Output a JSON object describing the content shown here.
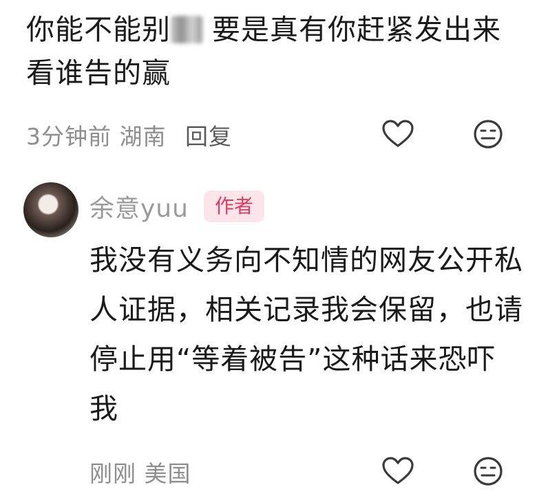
{
  "comment_top": {
    "text_before_blur": "你能不能别",
    "text_after_blur": "要是真有你赶紧发出来 看谁告的赢",
    "time": "3分钟前",
    "location": "湖南",
    "reply_label": "回复",
    "like_icon": "heart-outline-icon",
    "dislike_icon": "meh-face-icon"
  },
  "comment_reply": {
    "author_name": "余意yuu",
    "author_badge": "作者",
    "text": "我没有义务向不知情的网友公开私人证据，相关记录我会保留，也请停止用“等着被告”这种话来恐吓我",
    "time": "刚刚",
    "location": "美国",
    "like_icon": "heart-outline-icon",
    "dislike_icon": "meh-face-icon"
  }
}
